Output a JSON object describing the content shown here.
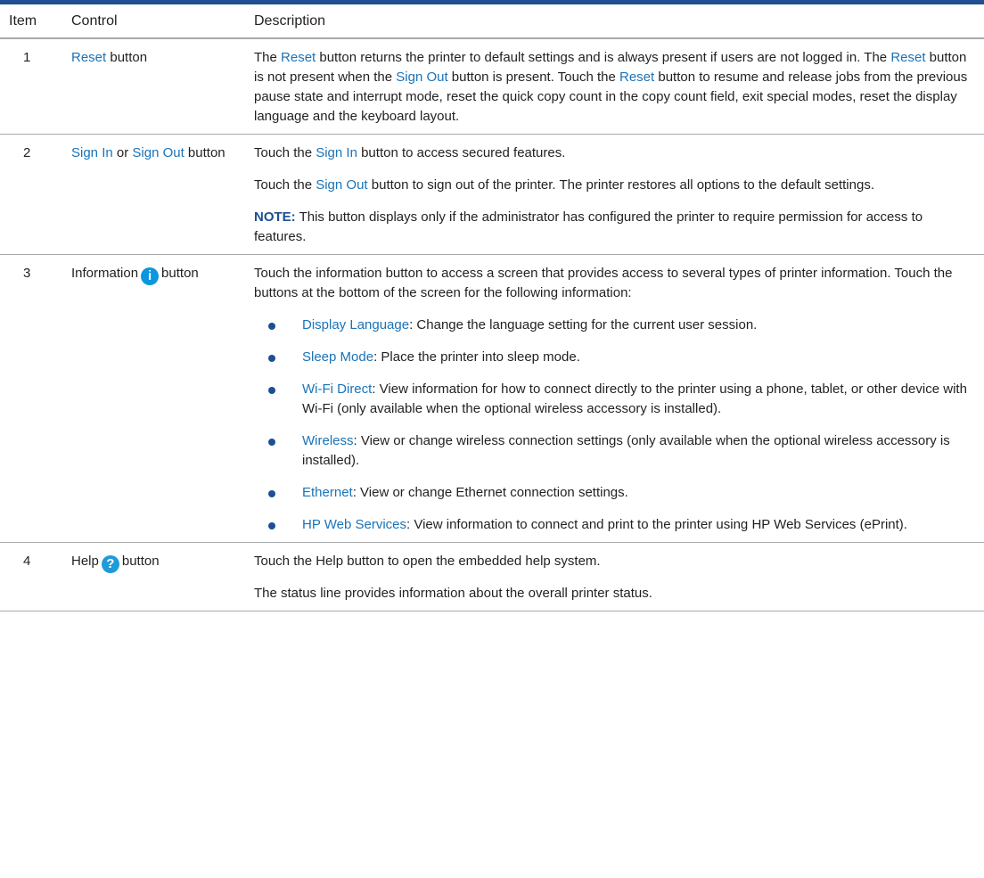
{
  "colors": {
    "rule": "#1d4f91",
    "term": "#1a73b8",
    "info_icon": "#0b96e0",
    "help_icon": "#1f9bd8"
  },
  "header": {
    "item": "Item",
    "control": "Control",
    "description": "Description"
  },
  "rows": [
    {
      "item": "1",
      "control": [
        {
          "t": "Reset",
          "style": "term"
        },
        {
          "t": " button"
        }
      ],
      "paragraphs": [
        [
          {
            "t": "The "
          },
          {
            "t": "Reset",
            "style": "term"
          },
          {
            "t": " button returns the printer to default settings and is always present if users are not logged in. The "
          },
          {
            "t": "Reset",
            "style": "term"
          },
          {
            "t": " button is not present when the "
          },
          {
            "t": "Sign Out",
            "style": "term"
          },
          {
            "t": " button is present. Touch the "
          },
          {
            "t": "Reset",
            "style": "term"
          },
          {
            "t": " button to resume and release jobs from the previous pause state and interrupt mode, reset the quick copy count in the copy count field, exit special modes, reset the display language and the keyboard layout."
          }
        ]
      ]
    },
    {
      "item": "2",
      "control": [
        {
          "t": "Sign In",
          "style": "term"
        },
        {
          "t": " or "
        },
        {
          "t": "Sign Out",
          "style": "term"
        },
        {
          "t": " button"
        }
      ],
      "paragraphs": [
        [
          {
            "t": "Touch the "
          },
          {
            "t": "Sign In",
            "style": "term"
          },
          {
            "t": " button to access secured features."
          }
        ],
        [
          {
            "t": "Touch the "
          },
          {
            "t": "Sign Out",
            "style": "term"
          },
          {
            "t": " button to sign out of the printer. The printer restores all options to the default settings."
          }
        ],
        [
          {
            "t": "NOTE:",
            "style": "note"
          },
          {
            "t": "    This button displays only if the administrator has configured the printer to require permission for access to features."
          }
        ]
      ]
    },
    {
      "item": "3",
      "control": [
        {
          "t": "Information"
        },
        {
          "icon": "information-icon"
        },
        {
          "t": "button"
        }
      ],
      "paragraphs": [
        [
          {
            "t": "Touch the information button to access a screen that provides access to several types of printer information. Touch the buttons at the bottom of the screen for the following information:"
          }
        ]
      ],
      "bullets": [
        [
          {
            "t": "Display Language",
            "style": "term"
          },
          {
            "t": ": Change the language setting for the current user session."
          }
        ],
        [
          {
            "t": "Sleep Mode",
            "style": "term"
          },
          {
            "t": ": Place the printer into sleep mode."
          }
        ],
        [
          {
            "t": "Wi-Fi Direct",
            "style": "term"
          },
          {
            "t": ": View information for how to connect directly to the printer using a phone, tablet, or other device with Wi-Fi (only available when the optional wireless accessory is installed)."
          }
        ],
        [
          {
            "t": "Wireless",
            "style": "term"
          },
          {
            "t": ": View or change wireless connection settings (only available when the optional wireless accessory is installed)."
          }
        ],
        [
          {
            "t": "Ethernet",
            "style": "term"
          },
          {
            "t": ": View or change Ethernet connection settings."
          }
        ],
        [
          {
            "t": "HP Web Services",
            "style": "term"
          },
          {
            "t": ": View information to connect and print to the printer using HP Web Services (ePrint)."
          }
        ]
      ]
    },
    {
      "item": "4",
      "control": [
        {
          "t": "Help"
        },
        {
          "icon": "help-icon"
        },
        {
          "t": "button"
        }
      ],
      "paragraphs": [
        [
          {
            "t": "Touch the Help button to open the embedded help system."
          }
        ],
        [
          {
            "t": "The status line provides information about the overall printer status."
          }
        ]
      ]
    }
  ]
}
